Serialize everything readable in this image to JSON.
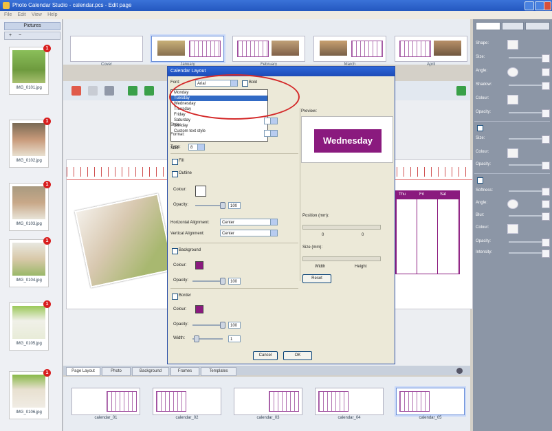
{
  "window": {
    "title": "Photo Calendar Studio - calendar.pcs - Edit page"
  },
  "menubar": {
    "items": [
      "File",
      "Edit",
      "View",
      "Help"
    ]
  },
  "left_panel": {
    "tab_label": "Pictures",
    "photos": [
      {
        "caption": "IMG_0101.jpg",
        "badge": "1"
      },
      {
        "caption": "IMG_0102.jpg",
        "badge": "1"
      },
      {
        "caption": "IMG_0103.jpg",
        "badge": "1"
      },
      {
        "caption": "IMG_0104.jpg",
        "badge": "1"
      },
      {
        "caption": "IMG_0105.jpg",
        "badge": "1"
      },
      {
        "caption": "IMG_0106.jpg",
        "badge": "1"
      }
    ]
  },
  "top_thumbs": {
    "captions": [
      "Cover",
      "January",
      "February",
      "March",
      "April"
    ]
  },
  "dialog": {
    "title": "Calendar Layout",
    "font_label": "Font:",
    "font_value": "Arial",
    "bold_label": "Bold",
    "dropdown_items": [
      "Monday",
      "Tuesday",
      "Wednesday",
      "Thursday",
      "Friday",
      "Saturday",
      "Sunday",
      "Custom text style"
    ],
    "dropdown_selected_index": 1,
    "row_labels": [
      "Style:",
      "Format:",
      "Type:",
      "Size:"
    ],
    "size_value": "8",
    "sections": {
      "fill": "Fill",
      "outline": "Outline",
      "background": "Background",
      "border": "Border"
    },
    "labels": {
      "colour": "Colour:",
      "opacity": "Opacity:",
      "h_align": "Horizontal Alignment:",
      "v_align": "Vertical Alignment:",
      "width": "Width:"
    },
    "opacity_value": "100",
    "h_align_value": "Center",
    "v_align_value": "Center",
    "bg_opacity_value": "100",
    "border_opacity_value": "100",
    "border_width_value": "1",
    "preview_label": "Preview:",
    "preview_text": "Wednesday",
    "position_label": "Position (mm):",
    "pos_left": "0",
    "pos_top": "0",
    "size_label": "Size (mm):",
    "size_w": "Width",
    "size_h": "Height",
    "reset_button": "Reset",
    "cancel_button": "Cancel",
    "ok_button": "OK",
    "colors": {
      "fill": "#ffffff",
      "background": "#8a1a7e",
      "border": "#8a1a7e"
    }
  },
  "canvas": {
    "days": [
      "Thu",
      "Fri",
      "Sat"
    ]
  },
  "bottom_tabs": [
    "Page Layout",
    "Photo",
    "Background",
    "Frames",
    "Templates"
  ],
  "bottom_thumbs": {
    "captions": [
      "calendar_01",
      "calendar_02",
      "calendar_03",
      "calendar_04",
      "calendar_05"
    ]
  },
  "right_panel": {
    "rows_a": [
      "Shape:",
      "Size:",
      "Angle:",
      "Shadow:",
      "Colour:",
      "Opacity:"
    ],
    "rows_b": [
      "Size:",
      "Colour:",
      "Opacity:"
    ],
    "rows_c": [
      "Softness:",
      "Angle:",
      "Blur:",
      "Colour:",
      "Opacity:",
      "Intensity:"
    ]
  },
  "accent": "#8a1a7e"
}
